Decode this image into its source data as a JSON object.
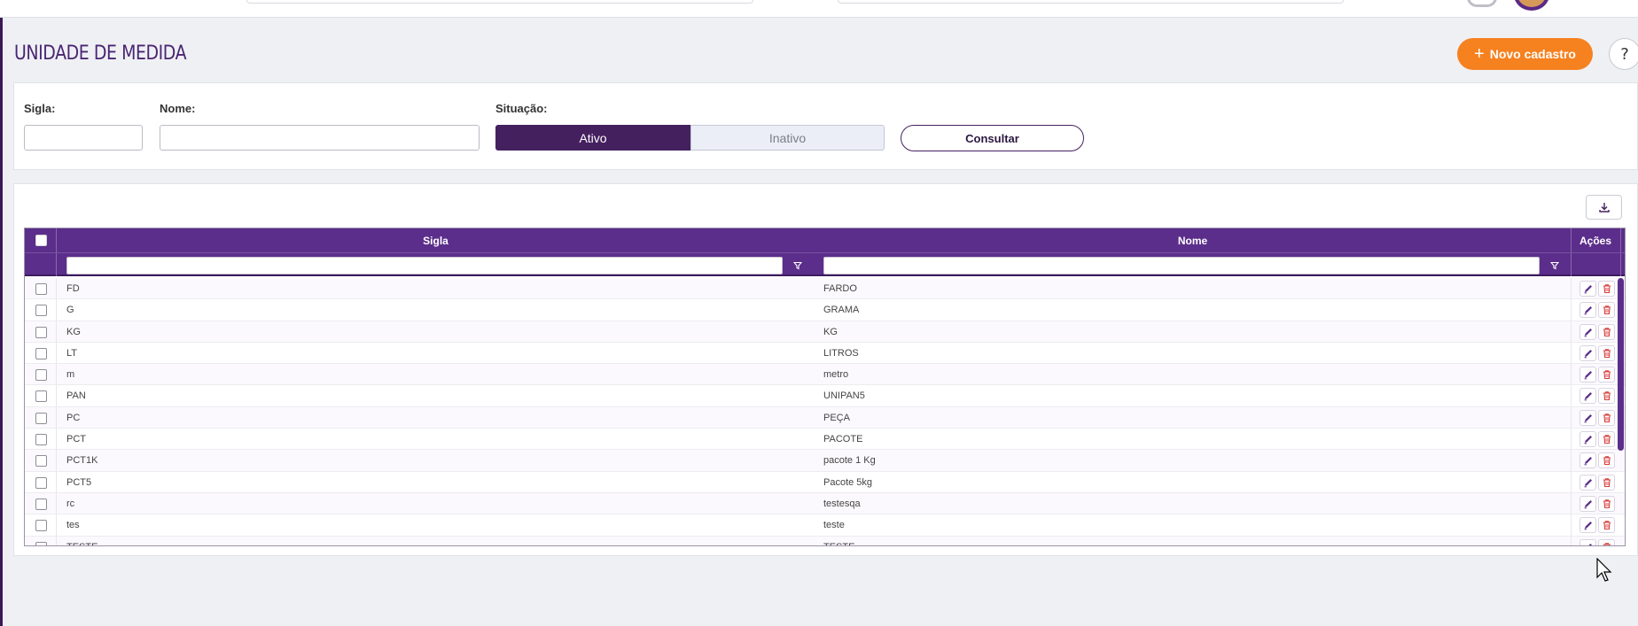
{
  "page": {
    "title": "UNIDADE DE MEDIDA",
    "new_button_label": "Novo cadastro",
    "help_label": "?"
  },
  "filters": {
    "sigla_label": "Sigla:",
    "nome_label": "Nome:",
    "situacao_label": "Situação:",
    "sigla_value": "",
    "nome_value": "",
    "situacao_options": [
      "Ativo",
      "Inativo"
    ],
    "situacao_selected": "Ativo",
    "submit_label": "Consultar"
  },
  "table": {
    "columns": {
      "sigla": "Sigla",
      "nome": "Nome",
      "acoes": "Ações"
    },
    "rows": [
      {
        "sigla": "FD",
        "nome": "FARDO"
      },
      {
        "sigla": "G",
        "nome": "GRAMA"
      },
      {
        "sigla": "KG",
        "nome": "KG"
      },
      {
        "sigla": "LT",
        "nome": "LITROS"
      },
      {
        "sigla": "m",
        "nome": "metro"
      },
      {
        "sigla": "PAN",
        "nome": "UNIPAN5"
      },
      {
        "sigla": "PC",
        "nome": "PEÇA"
      },
      {
        "sigla": "PCT",
        "nome": "PACOTE"
      },
      {
        "sigla": "PCT1K",
        "nome": "pacote 1 Kg"
      },
      {
        "sigla": "PCT5",
        "nome": "Pacote 5kg"
      },
      {
        "sigla": "rc",
        "nome": "testesqa"
      },
      {
        "sigla": "tes",
        "nome": "teste"
      },
      {
        "sigla": "TESTE",
        "nome": "TESTE"
      }
    ]
  },
  "colors": {
    "brand_purple": "#5b2e8b",
    "dark_purple": "#45205f",
    "accent_orange": "#f6811f",
    "delete_red": "#d83a3a"
  },
  "icons": {
    "new": "plus-icon",
    "export": "download-icon",
    "filter": "filter-icon",
    "edit": "pencil-icon",
    "delete": "trash-icon"
  }
}
